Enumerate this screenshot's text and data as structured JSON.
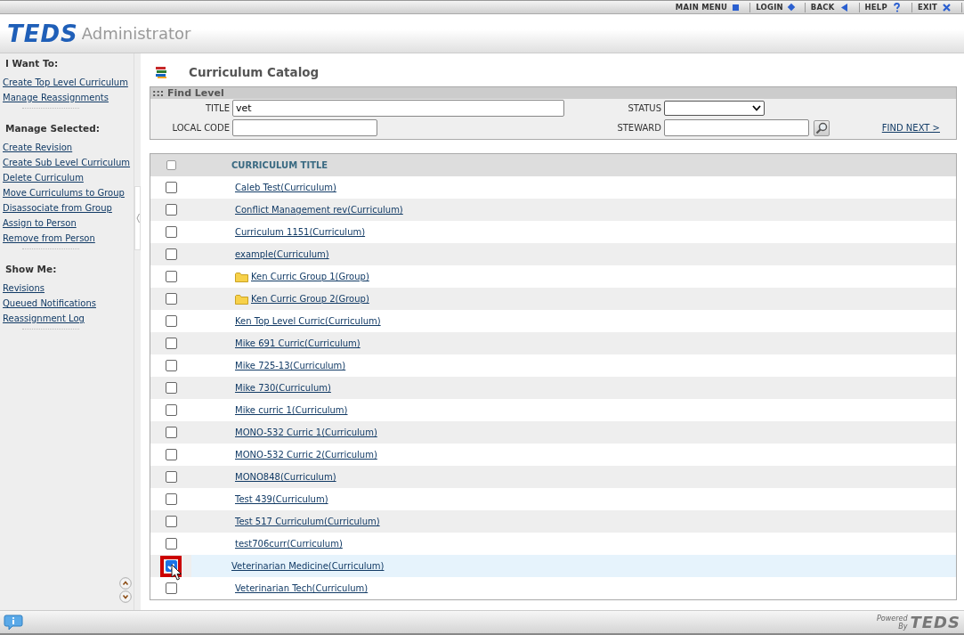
{
  "top_menu": [
    {
      "label": "MAIN MENU",
      "kind": "square"
    },
    {
      "label": "LOGIN",
      "kind": "diamond"
    },
    {
      "label": "BACK",
      "kind": "back"
    },
    {
      "label": "HELP",
      "kind": "help"
    },
    {
      "label": "EXIT",
      "kind": "exit"
    }
  ],
  "header": {
    "logo": "TEDS",
    "product": "Administrator"
  },
  "sidebar": {
    "sections": [
      {
        "title": "I Want To:",
        "items": [
          "Create Top Level Curriculum",
          "Manage Reassignments"
        ]
      },
      {
        "title": "Manage Selected:",
        "items": [
          "Create Revision",
          "Create Sub Level Curriculum",
          "Delete Curriculum",
          "Move Curriculums to Group",
          "Disassociate from Group",
          "Assign to Person",
          "Remove from Person"
        ]
      },
      {
        "title": "Show Me:",
        "items": [
          "Revisions",
          "Queued Notifications",
          "Reassignment Log"
        ]
      }
    ]
  },
  "page_title": "Curriculum Catalog",
  "find": {
    "title": "::: Find Level",
    "title_label": "TITLE",
    "title_value": "vet",
    "local_code_label": "LOCAL CODE",
    "status_label": "STATUS",
    "steward_label": "STEWARD",
    "find_next": "FIND NEXT >"
  },
  "table": {
    "column": "CURRICULUM TITLE",
    "select_all": false,
    "rows": [
      {
        "name": "Caleb Test",
        "type": "(Curriculum)",
        "kind": "curriculum",
        "checked": false,
        "callout": false
      },
      {
        "name": "Conflict Management rev",
        "type": "(Curriculum)",
        "kind": "curriculum",
        "checked": false,
        "callout": false
      },
      {
        "name": "Curriculum 1151",
        "type": "(Curriculum)",
        "kind": "curriculum",
        "checked": false,
        "callout": false
      },
      {
        "name": "example",
        "type": "(Curriculum)",
        "kind": "curriculum",
        "checked": false,
        "callout": false
      },
      {
        "name": "Ken Curric Group 1",
        "type": "(Group)",
        "kind": "group",
        "checked": false,
        "callout": false
      },
      {
        "name": "Ken Curric Group 2",
        "type": "(Group)",
        "kind": "group",
        "checked": false,
        "callout": false
      },
      {
        "name": "Ken Top Level Curric",
        "type": "(Curriculum)",
        "kind": "curriculum",
        "checked": false,
        "callout": false
      },
      {
        "name": "Mike 691 Curric",
        "type": "(Curriculum)",
        "kind": "curriculum",
        "checked": false,
        "callout": false
      },
      {
        "name": "Mike 725-13",
        "type": "(Curriculum)",
        "kind": "curriculum",
        "checked": false,
        "callout": false
      },
      {
        "name": "Mike 730",
        "type": "(Curriculum)",
        "kind": "curriculum",
        "checked": false,
        "callout": false
      },
      {
        "name": "Mike curric 1",
        "type": "(Curriculum)",
        "kind": "curriculum",
        "checked": false,
        "callout": false
      },
      {
        "name": "MONO-532 Curric 1",
        "type": "(Curriculum)",
        "kind": "curriculum",
        "checked": false,
        "callout": false
      },
      {
        "name": "MONO-532 Curric 2",
        "type": "(Curriculum)",
        "kind": "curriculum",
        "checked": false,
        "callout": false
      },
      {
        "name": "MONO848",
        "type": "(Curriculum)",
        "kind": "curriculum",
        "checked": false,
        "callout": false
      },
      {
        "name": "Test 439",
        "type": "(Curriculum)",
        "kind": "curriculum",
        "checked": false,
        "callout": false
      },
      {
        "name": "Test 517 Curriculum",
        "type": "(Curriculum)",
        "kind": "curriculum",
        "checked": false,
        "callout": false
      },
      {
        "name": "test706curr",
        "type": "(Curriculum)",
        "kind": "curriculum",
        "checked": false,
        "callout": false
      },
      {
        "name": "Veterinarian Medicine",
        "type": "(Curriculum)",
        "kind": "curriculum",
        "checked": true,
        "callout": true
      },
      {
        "name": "Veterinarian Tech",
        "type": "(Curriculum)",
        "kind": "curriculum",
        "checked": false,
        "callout": false
      }
    ]
  },
  "footer": {
    "powered": "Powered",
    "by": "By",
    "logo": "TEDS"
  }
}
